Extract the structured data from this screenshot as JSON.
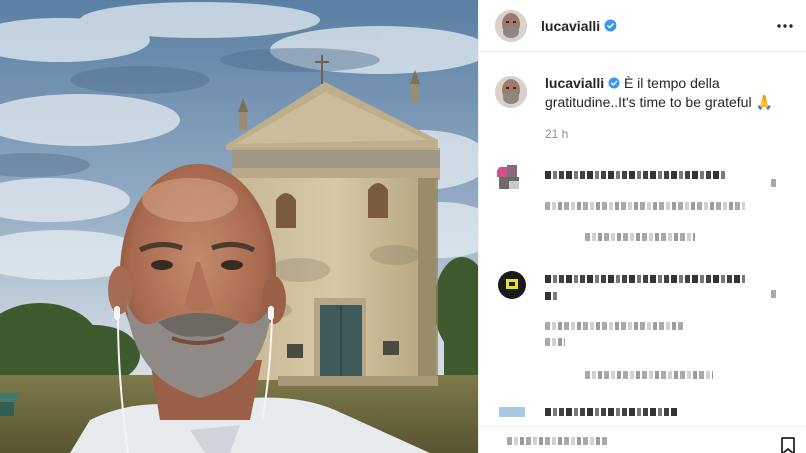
{
  "post": {
    "username": "lucavialli",
    "verified": true,
    "caption_text": "È il tempo della gratitudine..It's time to be grateful",
    "caption_emoji": "🙏",
    "timestamp": "21 h"
  },
  "icons": {
    "verified": "verified-badge-icon",
    "more": "more-options-icon",
    "bookmark": "bookmark-icon"
  },
  "colors": {
    "verified_blue": "#3897f0",
    "sky": "#6f8fae",
    "grass": "#6b6a3a"
  }
}
